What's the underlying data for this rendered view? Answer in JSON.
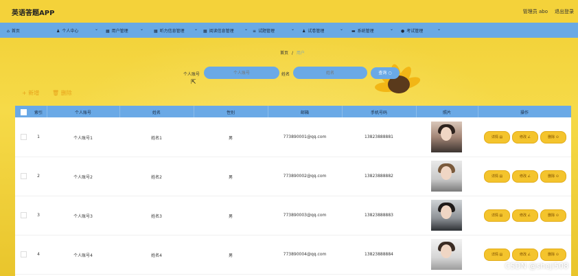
{
  "header": {
    "app_title": "英语答题APP",
    "admin_label": "管理员 abo",
    "logout_label": "退出登录"
  },
  "nav": [
    {
      "label": "首页",
      "icon": "home-icon"
    },
    {
      "label": "个人中心",
      "icon": "user-icon"
    },
    {
      "label": "用户管理",
      "icon": "grid-icon"
    },
    {
      "label": "听力信息管理",
      "icon": "grid-icon"
    },
    {
      "label": "阅读信息管理",
      "icon": "grid-icon"
    },
    {
      "label": "试题管理",
      "icon": "list-icon"
    },
    {
      "label": "试卷管理",
      "icon": "user-icon"
    },
    {
      "label": "系统管理",
      "icon": "monitor-icon"
    },
    {
      "label": "考试管理",
      "icon": "pin-icon"
    }
  ],
  "breadcrumb": {
    "home": "首页",
    "sep": "/",
    "current": "用户"
  },
  "search": {
    "account_label": "个人账号",
    "account_placeholder": "个人账号",
    "name_label": "姓名",
    "name_placeholder": "姓名",
    "query_label": "查询 ○"
  },
  "actions": {
    "add": "+ 新增",
    "delete": "🗑 删除"
  },
  "table": {
    "headers": [
      "索引",
      "个人账号",
      "姓名",
      "性别",
      "邮箱",
      "手机号码",
      "照片",
      "操作"
    ],
    "rows": [
      {
        "index": "1",
        "account": "个人账号1",
        "name": "姓名1",
        "gender": "男",
        "email": "773890001@qq.com",
        "phone": "13823888881"
      },
      {
        "index": "2",
        "account": "个人账号2",
        "name": "姓名2",
        "gender": "男",
        "email": "773890002@qq.com",
        "phone": "13823888882"
      },
      {
        "index": "3",
        "account": "个人账号3",
        "name": "姓名3",
        "gender": "男",
        "email": "773890003@qq.com",
        "phone": "13823888883"
      },
      {
        "index": "4",
        "account": "个人账号4",
        "name": "姓名4",
        "gender": "男",
        "email": "773890004@qq.com",
        "phone": "13823888884"
      }
    ],
    "buttons": {
      "detail": "详情 ▤",
      "edit": "修改 ∠",
      "delete": "删除 ⊙"
    }
  },
  "watermark": "CSDN @sheji508",
  "colors": {
    "nav_blue": "#69a9e4",
    "header_yellow": "#f4d23a",
    "button_yellow": "#f4c42d",
    "action_orange": "#e7a21b"
  }
}
